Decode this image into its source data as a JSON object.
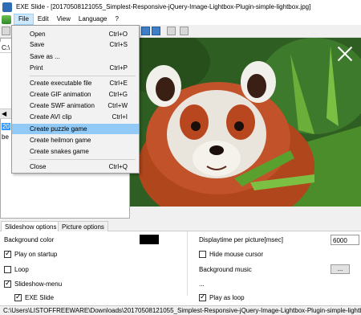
{
  "window": {
    "title": "EXE Slide - [20170508121055_Simplest-Responsive-jQuery-Image-Lightbox-Plugin-simple-lightbox.jpg]"
  },
  "menubar": {
    "items": [
      "File",
      "Edit",
      "View",
      "Language",
      "?"
    ]
  },
  "left_panel": {
    "path": "C:\\",
    "list": [
      "20",
      "be"
    ]
  },
  "file_menu": {
    "items": [
      {
        "label": "Open",
        "shortcut": "Ctrl+O"
      },
      {
        "label": "Save",
        "shortcut": "Ctrl+S"
      },
      {
        "label": "Save as ...",
        "shortcut": ""
      },
      {
        "label": "Print",
        "shortcut": "Ctrl+P"
      },
      {
        "label": "Create executable file",
        "shortcut": "Ctrl+E"
      },
      {
        "label": "Create GIF animation",
        "shortcut": "Ctrl+G"
      },
      {
        "label": "Create SWF animation",
        "shortcut": "Ctrl+W"
      },
      {
        "label": "Create AVI clip",
        "shortcut": "Ctrl+I"
      },
      {
        "label": "Create puzzle game",
        "shortcut": ""
      },
      {
        "label": "Create heilmon game",
        "shortcut": ""
      },
      {
        "label": "Create snakes game",
        "shortcut": ""
      },
      {
        "label": "Close",
        "shortcut": "Ctrl+Q"
      }
    ],
    "highlighted": "Create puzzle game"
  },
  "tabs": [
    "Slideshow options",
    "Picture options"
  ],
  "options": {
    "background_color_label": "Background color",
    "background_color": "#000000",
    "play_on_startup": "Play on startup",
    "loop": "Loop",
    "slideshow_menu": "Slideshow-menu",
    "exe_slide": "EXE Slide",
    "displaytime_label": "Displaytime per picture[msec]",
    "displaytime_value": "6000",
    "hide_mouse_cursor": "Hide mouse cursor",
    "background_music": "Background music",
    "browse_button": "...",
    "music_path": "...",
    "play_as_loop": "Play as loop"
  },
  "statusbar": {
    "text": "C:\\Users\\LISTOFFREEWARE\\Downloads\\20170508121055_Simplest-Responsive-jQuery-Image-Lightbox-Plugin-simple-lightbox.jpg"
  }
}
